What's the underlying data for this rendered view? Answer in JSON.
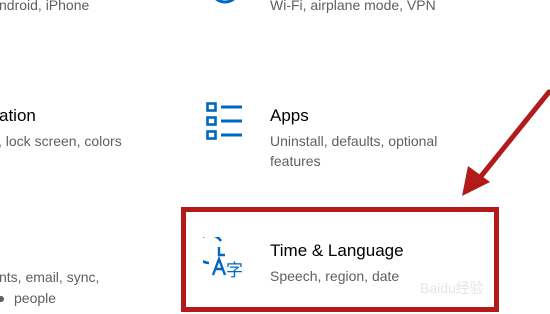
{
  "tiles": {
    "phone": {
      "desc_line1": "ndroid, iPhone"
    },
    "network": {
      "desc_line1": "Wi-Fi, airplane mode, VPN"
    },
    "personalization": {
      "title": "ation",
      "desc_line1": ", lock screen, colors"
    },
    "apps": {
      "title": "Apps",
      "desc_line1": "Uninstall, defaults, optional",
      "desc_line2": "features",
      "icon": "apps-list-icon"
    },
    "accounts": {
      "desc_line1": "nts, email, sync,",
      "desc_line2": "people"
    },
    "time_language": {
      "title": "Time & Language",
      "desc_line1": "Speech, region, date",
      "icon": "time-language-icon"
    }
  },
  "annotation": {
    "highlight_color": "#b31b1b",
    "arrow_color": "#b31b1b"
  },
  "watermark": {
    "text": "Baidu经验"
  },
  "colors": {
    "accent": "#0067c0",
    "text_secondary": "#5f5f5f"
  }
}
